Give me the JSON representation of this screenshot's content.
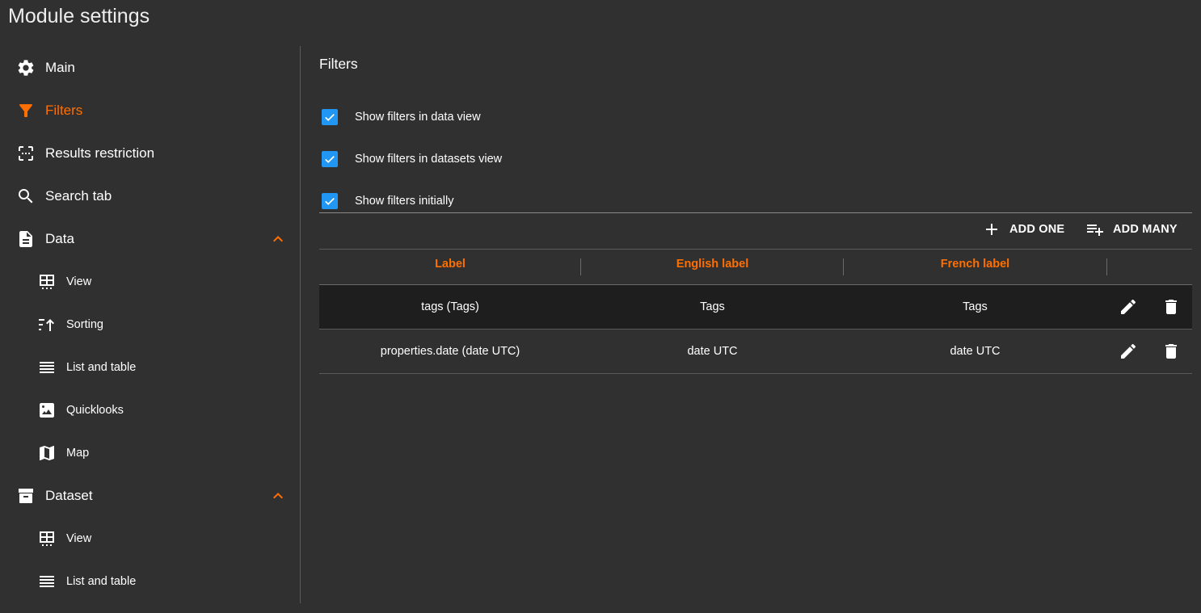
{
  "title": "Module settings",
  "sidebar": {
    "items": [
      {
        "label": "Main",
        "icon": "gear-icon"
      },
      {
        "label": "Filters",
        "icon": "filter-icon",
        "active": true
      },
      {
        "label": "Results restriction",
        "icon": "crop-free-icon"
      },
      {
        "label": "Search tab",
        "icon": "search-icon"
      },
      {
        "label": "Data",
        "icon": "document-icon",
        "expanded": true
      },
      {
        "label": "View",
        "icon": "table-view-icon"
      },
      {
        "label": "Sorting",
        "icon": "sort-icon"
      },
      {
        "label": "List and table",
        "icon": "list-icon"
      },
      {
        "label": "Quicklooks",
        "icon": "image-icon"
      },
      {
        "label": "Map",
        "icon": "map-icon"
      },
      {
        "label": "Dataset",
        "icon": "archive-icon",
        "expanded": true
      },
      {
        "label": "View",
        "icon": "table-view-icon"
      },
      {
        "label": "List and table",
        "icon": "list-icon"
      }
    ]
  },
  "main": {
    "section_title": "Filters",
    "checkboxes": [
      {
        "label": "Show filters in data view",
        "checked": true
      },
      {
        "label": "Show filters in datasets view",
        "checked": true
      },
      {
        "label": "Show filters initially",
        "checked": true
      }
    ],
    "toolbar": {
      "add_one": "ADD ONE",
      "add_many": "ADD MANY"
    },
    "table": {
      "headers": [
        "Label",
        "English label",
        "French label"
      ],
      "rows": [
        {
          "label": "tags (Tags)",
          "english": "Tags",
          "french": "Tags"
        },
        {
          "label": "properties.date (date UTC)",
          "english": "date UTC",
          "french": "date UTC"
        }
      ]
    }
  },
  "colors": {
    "background": "#303030",
    "accent": "#ff6f00",
    "checkbox": "#2196f3",
    "row_highlight": "#1e1e1e"
  }
}
